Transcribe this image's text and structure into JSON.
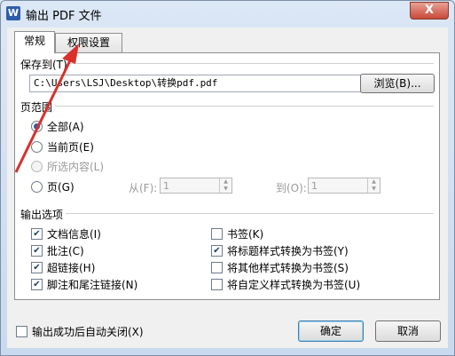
{
  "window": {
    "title": "输出 PDF 文件",
    "close_glyph": "X"
  },
  "tabs": [
    {
      "label": "常规"
    },
    {
      "label": "权限设置"
    }
  ],
  "save": {
    "group_label": "保存到(T)",
    "path": "C:\\Users\\LSJ\\Desktop\\转换pdf.pdf",
    "browse_label": "浏览(B)..."
  },
  "range": {
    "group_label": "页范围",
    "options": [
      {
        "label": "全部(A)"
      },
      {
        "label": "当前页(E)"
      },
      {
        "label": "所选内容(L)"
      },
      {
        "label": "页(G)"
      }
    ],
    "from_label": "从(F):",
    "from_value": "1",
    "to_label": "到(O):",
    "to_value": "1"
  },
  "output": {
    "group_label": "输出选项",
    "left": [
      {
        "label": "文档信息(I)"
      },
      {
        "label": "批注(C)"
      },
      {
        "label": "超链接(H)"
      },
      {
        "label": "脚注和尾注链接(N)"
      }
    ],
    "right": [
      {
        "label": "书签(K)"
      },
      {
        "label": "将标题样式转换为书签(Y)"
      },
      {
        "label": "将其他样式转换为书签(S)"
      },
      {
        "label": "将自定义样式转换为书签(U)"
      }
    ]
  },
  "footer": {
    "auto_close_label": "输出成功后自动关闭(X)",
    "ok_label": "确定",
    "cancel_label": "取消"
  },
  "colors": {
    "annotation_arrow": "#d9302c",
    "accent": "#2d5f9e"
  }
}
